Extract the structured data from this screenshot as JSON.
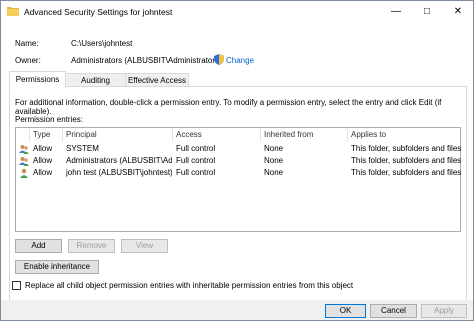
{
  "window": {
    "title": "Advanced Security Settings for johntest",
    "minimize": "—",
    "maximize": "□",
    "close": "✕"
  },
  "details": {
    "name_label": "Name:",
    "name_value": "C:\\Users\\johntest",
    "owner_label": "Owner:",
    "owner_value": "Administrators (ALBUSBIT\\Administrators)",
    "change_link": "Change"
  },
  "tabs": [
    {
      "label": "Permissions",
      "active": true
    },
    {
      "label": "Auditing",
      "active": false
    },
    {
      "label": "Effective Access",
      "active": false
    }
  ],
  "info_text": "For additional information, double-click a permission entry. To modify a permission entry, select the entry and click Edit (if available).",
  "entries_label": "Permission entries:",
  "columns": [
    "Type",
    "Principal",
    "Access",
    "Inherited from",
    "Applies to"
  ],
  "entries": [
    {
      "type": "Allow",
      "principal": "SYSTEM",
      "access": "Full control",
      "inherited": "None",
      "applies": "This folder, subfolders and files",
      "icon": "group-icon"
    },
    {
      "type": "Allow",
      "principal": "Administrators (ALBUSBIT\\Ad...",
      "access": "Full control",
      "inherited": "None",
      "applies": "This folder, subfolders and files",
      "icon": "group-icon"
    },
    {
      "type": "Allow",
      "principal": "john test (ALBUSBIT\\johntest)",
      "access": "Full control",
      "inherited": "None",
      "applies": "This folder, subfolders and files",
      "icon": "user-icon"
    }
  ],
  "buttons": {
    "add": "Add",
    "remove": "Remove",
    "view": "View",
    "enable_inheritance": "Enable inheritance",
    "ok": "OK",
    "cancel": "Cancel",
    "apply": "Apply"
  },
  "replace_checkbox": {
    "label": "Replace all child object permission entries with inheritable permission entries from this object",
    "checked": false
  },
  "colors": {
    "link": "#0066cc",
    "accent": "#0078d7",
    "folder": "#e8b73a"
  }
}
